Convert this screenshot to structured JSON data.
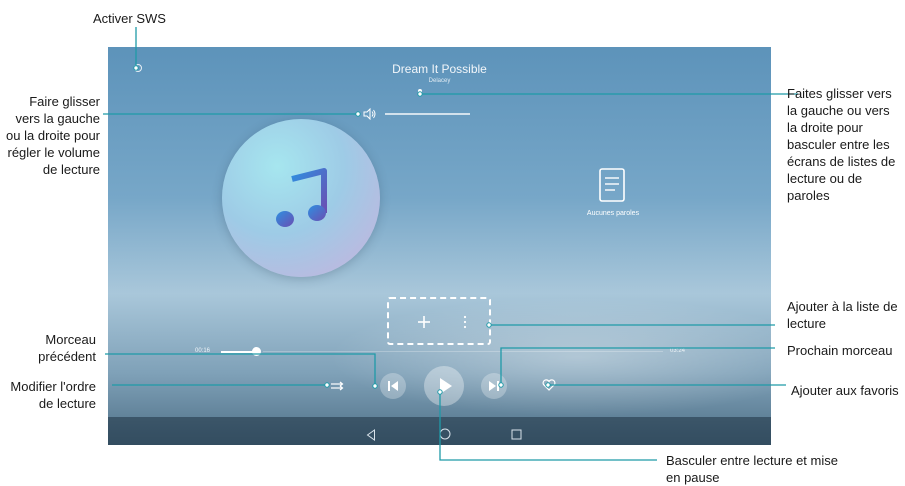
{
  "player": {
    "song_title": "Dream It Possible",
    "artist": "Delacey",
    "lyrics_status": "Aucunes paroles",
    "time_elapsed": "00:16",
    "time_total": "03:24",
    "progress_fraction": 0.08
  },
  "callouts": {
    "sws": "Activer SWS",
    "volume": "Faire glisser vers la gauche ou la droite pour régler le volume de lecture",
    "swipe": "Faites glisser vers la gauche ou vers la droite pour basculer entre les écrans de listes de lecture ou de paroles",
    "playlist": "Ajouter à la liste de lecture",
    "previous": "Morceau précédent",
    "next": "Prochain morceau",
    "shuffle": "Modifier l'ordre de lecture",
    "favorites": "Ajouter aux favoris",
    "play_pause": "Basculer entre lecture et mise en pause"
  },
  "icons": {
    "sws": "sws-icon",
    "volume": "volume-icon",
    "lyrics": "document-icon",
    "add": "plus-icon",
    "more": "more-vertical-icon",
    "previous": "skip-previous-icon",
    "play": "play-icon",
    "next": "skip-next-icon",
    "shuffle": "shuffle-icon",
    "favorite": "heart-icon",
    "nav_back": "back-icon",
    "nav_home": "home-icon",
    "nav_recent": "recent-apps-icon"
  },
  "colors": {
    "callout_line": "#1f9aa8",
    "accent": "#5d93ba"
  }
}
